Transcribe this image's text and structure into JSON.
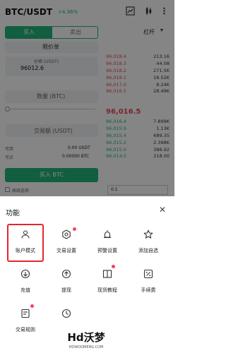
{
  "header": {
    "pair": "BTC/USDT",
    "change": "+4.36%"
  },
  "trade_tabs": {
    "buy": "买入",
    "sell": "卖出"
  },
  "leverage": {
    "label": "杠杆"
  },
  "order_form": {
    "order_type": "限价单",
    "price_label": "价格 (USDT)",
    "price_value": "96012.6",
    "qty_label": "数量 (BTC)",
    "amount_label": "交易额 (USDT)",
    "available_label": "可用",
    "available_value": "0.00 USDT",
    "max_label": "可买",
    "max_value": "0.00000 BTC",
    "submit": "买入 BTC",
    "advanced": "高级选项",
    "depth_step": "0.1"
  },
  "orderbook": {
    "asks": [
      {
        "price": "96,018.4",
        "qty": "213.16"
      },
      {
        "price": "96,018.3",
        "qty": "44.08"
      },
      {
        "price": "96,018.2",
        "qty": "271.5K"
      },
      {
        "price": "96,018.1",
        "qty": "18.52K"
      },
      {
        "price": "96,017.0",
        "qty": "8.24K"
      },
      {
        "price": "96,016.5",
        "qty": "28.49K"
      }
    ],
    "last_price": "96,016.5",
    "bids": [
      {
        "price": "96,016.4",
        "qty": "7.899K"
      },
      {
        "price": "96,015.9",
        "qty": "1.13K"
      },
      {
        "price": "96,015.4",
        "qty": "689.35"
      },
      {
        "price": "96,015.2",
        "qty": "2.398K"
      },
      {
        "price": "96,015.0",
        "qty": "386.92"
      },
      {
        "price": "96,014.5",
        "qty": "218.00"
      }
    ]
  },
  "sheet": {
    "title": "功能",
    "items": [
      {
        "label": "账户模式",
        "icon": "account-mode-icon"
      },
      {
        "label": "交易设置",
        "icon": "trade-settings-icon"
      },
      {
        "label": "预警设置",
        "icon": "alert-settings-icon"
      },
      {
        "label": "添加自选",
        "icon": "star-icon"
      },
      {
        "label": "充值",
        "icon": "deposit-icon"
      },
      {
        "label": "提现",
        "icon": "withdraw-icon"
      },
      {
        "label": "现货教程",
        "icon": "book-icon"
      },
      {
        "label": "手续费",
        "icon": "fee-icon"
      },
      {
        "label": "交易规则",
        "icon": "rules-icon"
      },
      {
        "label": "",
        "icon": "history-icon"
      }
    ]
  },
  "watermark": {
    "main": "Hd沃梦",
    "sub": "HDWOOMENG.COM"
  },
  "colors": {
    "accent": "#21b47c",
    "ask": "#f0465a",
    "highlight": "#e6252b"
  }
}
